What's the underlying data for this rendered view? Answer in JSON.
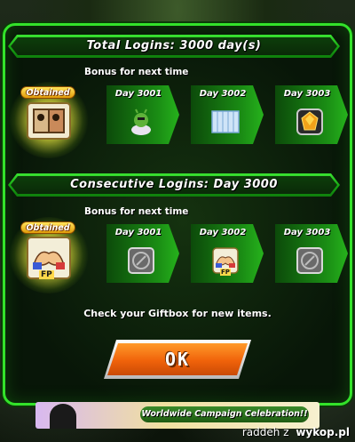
{
  "total_logins": {
    "title": "Total Logins: 3000 day(s)",
    "bonus_label": "Bonus for next time",
    "obtained_label": "Obtained",
    "days": [
      {
        "label": "Day 3001",
        "reward_icon": "green-warrior-icon"
      },
      {
        "label": "Day 3002",
        "reward_icon": "blue-tickets-icon"
      },
      {
        "label": "Day 3003",
        "reward_icon": "orange-stone-icon"
      }
    ]
  },
  "consecutive_logins": {
    "title": "Consecutive Logins: Day 3000",
    "bonus_label": "Bonus for next time",
    "obtained_label": "Obtained",
    "days": [
      {
        "label": "Day 3001",
        "reward_icon": "locked-badge-icon"
      },
      {
        "label": "Day 3002",
        "reward_icon": "friend-points-icon",
        "badge": "FP"
      },
      {
        "label": "Day 3003",
        "reward_icon": "locked-badge-icon"
      }
    ],
    "obtained_badge": "FP"
  },
  "info_message": "Check your Giftbox for new items.",
  "ok_button": "OK",
  "banner_text": "Worldwide Campaign Celebration!!",
  "watermark": {
    "user": "raddeh",
    "z": "z",
    "site": "wykop.pl"
  },
  "colors": {
    "accent_green": "#33e22a",
    "ok_orange": "#f0620a"
  }
}
